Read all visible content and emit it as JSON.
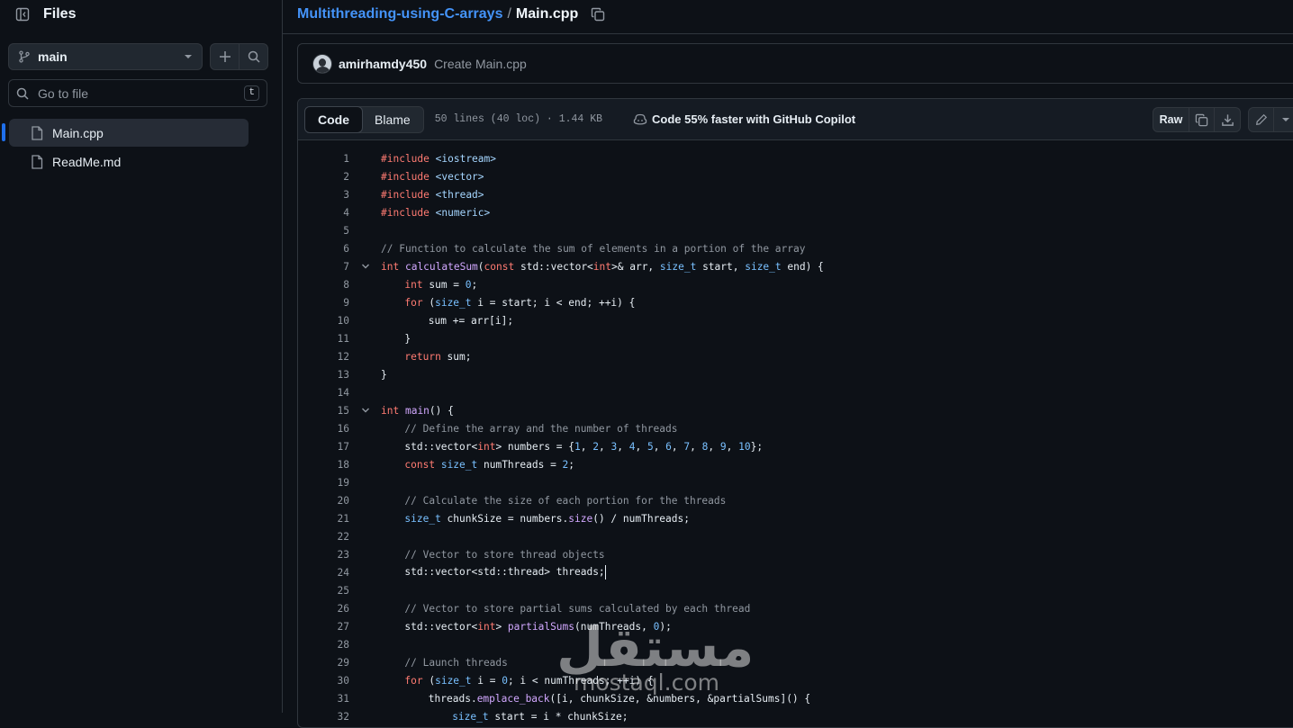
{
  "sidebar": {
    "title": "Files",
    "branch": "main",
    "goto_placeholder": "Go to file",
    "goto_shortcut": "t",
    "files": [
      {
        "name": "Main.cpp",
        "active": true
      },
      {
        "name": "ReadMe.md",
        "active": false
      }
    ]
  },
  "breadcrumb": {
    "repo": "Multithreading-using-C-arrays",
    "separator": "/",
    "file": "Main.cpp"
  },
  "commit": {
    "author": "amirhamdy450",
    "message": "Create Main.cpp"
  },
  "file_header": {
    "tabs": [
      "Code",
      "Blame"
    ],
    "selected_tab": "Code",
    "stats": "50 lines (40 loc) · 1.44 KB",
    "copilot": "Code 55% faster with GitHub Copilot",
    "raw_label": "Raw"
  },
  "code_lines": [
    {
      "n": "1",
      "fold": false,
      "indent": 0,
      "tokens": [
        [
          "kw",
          "#include"
        ],
        [
          "txt",
          " "
        ],
        [
          "st",
          "<iostream>"
        ]
      ]
    },
    {
      "n": "2",
      "fold": false,
      "indent": 0,
      "tokens": [
        [
          "kw",
          "#include"
        ],
        [
          "txt",
          " "
        ],
        [
          "st",
          "<vector>"
        ]
      ]
    },
    {
      "n": "3",
      "fold": false,
      "indent": 0,
      "tokens": [
        [
          "kw",
          "#include"
        ],
        [
          "txt",
          " "
        ],
        [
          "st",
          "<thread>"
        ]
      ]
    },
    {
      "n": "4",
      "fold": false,
      "indent": 0,
      "tokens": [
        [
          "kw",
          "#include"
        ],
        [
          "txt",
          " "
        ],
        [
          "st",
          "<numeric>"
        ]
      ]
    },
    {
      "n": "5",
      "fold": false,
      "indent": 0,
      "tokens": []
    },
    {
      "n": "6",
      "fold": false,
      "indent": 0,
      "tokens": [
        [
          "cm",
          "// Function to calculate the sum of elements in a portion of the array"
        ]
      ]
    },
    {
      "n": "7",
      "fold": true,
      "indent": 0,
      "tokens": [
        [
          "kw",
          "int"
        ],
        [
          "txt",
          " "
        ],
        [
          "fn",
          "calculateSum"
        ],
        [
          "txt",
          "("
        ],
        [
          "kw",
          "const"
        ],
        [
          "txt",
          " std::vector<"
        ],
        [
          "kw",
          "int"
        ],
        [
          "txt",
          ">& arr, "
        ],
        [
          "ty",
          "size_t"
        ],
        [
          "txt",
          " start, "
        ],
        [
          "ty",
          "size_t"
        ],
        [
          "txt",
          " end) {"
        ]
      ]
    },
    {
      "n": "8",
      "fold": false,
      "indent": 4,
      "tokens": [
        [
          "kw",
          "int"
        ],
        [
          "txt",
          " sum = "
        ],
        [
          "nu",
          "0"
        ],
        [
          "txt",
          ";"
        ]
      ]
    },
    {
      "n": "9",
      "fold": false,
      "indent": 4,
      "tokens": [
        [
          "kw",
          "for"
        ],
        [
          "txt",
          " ("
        ],
        [
          "ty",
          "size_t"
        ],
        [
          "txt",
          " i = start; i < end; ++i) {"
        ]
      ]
    },
    {
      "n": "10",
      "fold": false,
      "indent": 8,
      "tokens": [
        [
          "txt",
          "sum += arr[i];"
        ]
      ]
    },
    {
      "n": "11",
      "fold": false,
      "indent": 4,
      "tokens": [
        [
          "txt",
          "}"
        ]
      ]
    },
    {
      "n": "12",
      "fold": false,
      "indent": 4,
      "tokens": [
        [
          "kw",
          "return"
        ],
        [
          "txt",
          " sum;"
        ]
      ]
    },
    {
      "n": "13",
      "fold": false,
      "indent": 0,
      "tokens": [
        [
          "txt",
          "}"
        ]
      ]
    },
    {
      "n": "14",
      "fold": false,
      "indent": 0,
      "tokens": []
    },
    {
      "n": "15",
      "fold": true,
      "indent": 0,
      "tokens": [
        [
          "kw",
          "int"
        ],
        [
          "txt",
          " "
        ],
        [
          "fn",
          "main"
        ],
        [
          "txt",
          "() {"
        ]
      ]
    },
    {
      "n": "16",
      "fold": false,
      "indent": 4,
      "tokens": [
        [
          "cm",
          "// Define the array and the number of threads"
        ]
      ]
    },
    {
      "n": "17",
      "fold": false,
      "indent": 4,
      "tokens": [
        [
          "txt",
          "std::vector<"
        ],
        [
          "kw",
          "int"
        ],
        [
          "txt",
          "> numbers = {"
        ],
        [
          "nu",
          "1"
        ],
        [
          "txt",
          ", "
        ],
        [
          "nu",
          "2"
        ],
        [
          "txt",
          ", "
        ],
        [
          "nu",
          "3"
        ],
        [
          "txt",
          ", "
        ],
        [
          "nu",
          "4"
        ],
        [
          "txt",
          ", "
        ],
        [
          "nu",
          "5"
        ],
        [
          "txt",
          ", "
        ],
        [
          "nu",
          "6"
        ],
        [
          "txt",
          ", "
        ],
        [
          "nu",
          "7"
        ],
        [
          "txt",
          ", "
        ],
        [
          "nu",
          "8"
        ],
        [
          "txt",
          ", "
        ],
        [
          "nu",
          "9"
        ],
        [
          "txt",
          ", "
        ],
        [
          "nu",
          "10"
        ],
        [
          "txt",
          "};"
        ]
      ]
    },
    {
      "n": "18",
      "fold": false,
      "indent": 4,
      "tokens": [
        [
          "kw",
          "const"
        ],
        [
          "txt",
          " "
        ],
        [
          "ty",
          "size_t"
        ],
        [
          "txt",
          " numThreads = "
        ],
        [
          "nu",
          "2"
        ],
        [
          "txt",
          ";"
        ]
      ]
    },
    {
      "n": "19",
      "fold": false,
      "indent": 0,
      "tokens": []
    },
    {
      "n": "20",
      "fold": false,
      "indent": 4,
      "tokens": [
        [
          "cm",
          "// Calculate the size of each portion for the threads"
        ]
      ]
    },
    {
      "n": "21",
      "fold": false,
      "indent": 4,
      "tokens": [
        [
          "ty",
          "size_t"
        ],
        [
          "txt",
          " chunkSize = numbers."
        ],
        [
          "fn",
          "size"
        ],
        [
          "txt",
          "() / numThreads;"
        ]
      ]
    },
    {
      "n": "22",
      "fold": false,
      "indent": 0,
      "tokens": []
    },
    {
      "n": "23",
      "fold": false,
      "indent": 4,
      "tokens": [
        [
          "cm",
          "// Vector to store thread objects"
        ]
      ]
    },
    {
      "n": "24",
      "fold": false,
      "indent": 4,
      "tokens": [
        [
          "txt",
          "std::vector<std::thread> threads;"
        ]
      ],
      "caret": true
    },
    {
      "n": "25",
      "fold": false,
      "indent": 0,
      "tokens": []
    },
    {
      "n": "26",
      "fold": false,
      "indent": 4,
      "tokens": [
        [
          "cm",
          "// Vector to store partial sums calculated by each thread"
        ]
      ]
    },
    {
      "n": "27",
      "fold": false,
      "indent": 4,
      "tokens": [
        [
          "txt",
          "std::vector<"
        ],
        [
          "kw",
          "int"
        ],
        [
          "txt",
          "> "
        ],
        [
          "fn",
          "partialSums"
        ],
        [
          "txt",
          "(numThreads, "
        ],
        [
          "nu",
          "0"
        ],
        [
          "txt",
          ");"
        ]
      ]
    },
    {
      "n": "28",
      "fold": false,
      "indent": 0,
      "tokens": []
    },
    {
      "n": "29",
      "fold": false,
      "indent": 4,
      "tokens": [
        [
          "cm",
          "// Launch threads"
        ]
      ]
    },
    {
      "n": "30",
      "fold": false,
      "indent": 4,
      "tokens": [
        [
          "kw",
          "for"
        ],
        [
          "txt",
          " ("
        ],
        [
          "ty",
          "size_t"
        ],
        [
          "txt",
          " i = "
        ],
        [
          "nu",
          "0"
        ],
        [
          "txt",
          "; i < numThreads; ++i) {"
        ]
      ]
    },
    {
      "n": "31",
      "fold": false,
      "indent": 8,
      "tokens": [
        [
          "txt",
          "threads."
        ],
        [
          "fn",
          "emplace_back"
        ],
        [
          "txt",
          "([i, chunkSize, &numbers, &partialSums]() {"
        ]
      ]
    },
    {
      "n": "32",
      "fold": false,
      "indent": 12,
      "tokens": [
        [
          "ty",
          "size_t"
        ],
        [
          "txt",
          " start = i * chunkSize;"
        ]
      ]
    }
  ],
  "watermark": {
    "arabic": "مستقل",
    "latin": "mostaql.com"
  },
  "colors": {
    "accent": "#4493f8",
    "keyword": "#ff7b72",
    "type": "#79c0ff",
    "string": "#a5d6ff",
    "comment": "#9198a1",
    "function": "#d2a8ff"
  }
}
